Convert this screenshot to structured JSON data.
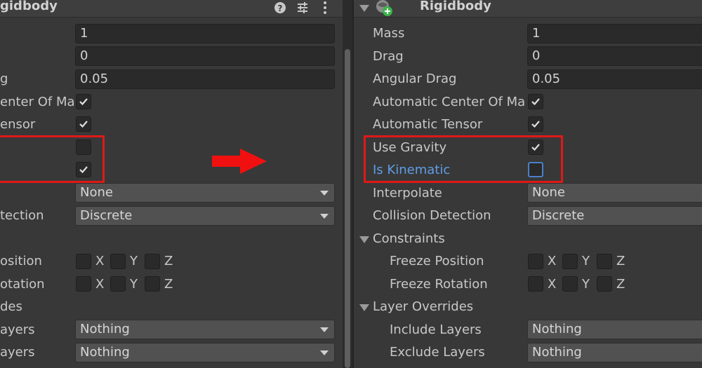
{
  "left": {
    "header_title": "gidbody",
    "labels": [
      "",
      "",
      "g",
      "enter Of Ma",
      "ensor",
      "",
      "",
      "",
      "tection",
      "",
      "osition",
      "otation",
      "des",
      "ayers",
      "ayers"
    ],
    "mass": "1",
    "drag": "0",
    "angular_drag": "0.05",
    "interpolate": "None",
    "collision_detection": "Discrete",
    "include_layers": "Nothing",
    "exclude_layers": "Nothing"
  },
  "right": {
    "header_title": "Rigidbody",
    "labels": {
      "mass": "Mass",
      "drag": "Drag",
      "angular_drag": "Angular Drag",
      "auto_center": "Automatic Center Of Ma",
      "auto_tensor": "Automatic Tensor",
      "use_gravity": "Use Gravity",
      "is_kinematic": "Is Kinematic",
      "interpolate": "Interpolate",
      "collision_detection": "Collision Detection",
      "constraints": "Constraints",
      "freeze_position": "Freeze Position",
      "freeze_rotation": "Freeze Rotation",
      "layer_overrides": "Layer Overrides",
      "include_layers": "Include Layers",
      "exclude_layers": "Exclude Layers"
    },
    "mass": "1",
    "drag": "0",
    "angular_drag": "0.05",
    "interpolate": "None",
    "collision_detection": "Discrete",
    "include_layers": "Nothing",
    "exclude_layers": "Nothing"
  },
  "axes": {
    "x": "X",
    "y": "Y",
    "z": "Z"
  },
  "checkbox_state": {
    "left": {
      "auto_center": true,
      "auto_tensor": true,
      "use_gravity": false,
      "is_kinematic": true
    },
    "right": {
      "auto_center": true,
      "auto_tensor": true,
      "use_gravity": true,
      "is_kinematic": false
    }
  },
  "icons": {
    "help": "help-icon",
    "presets": "presets-icon",
    "more": "more-options-icon",
    "component": "rigidbody-component-icon",
    "arrow": "right-arrow-annotation"
  },
  "colors": {
    "highlight_box": "#e01818",
    "arrow": "#f01010",
    "kinematic_label": "#5f9ee8",
    "panel": "#383838"
  }
}
